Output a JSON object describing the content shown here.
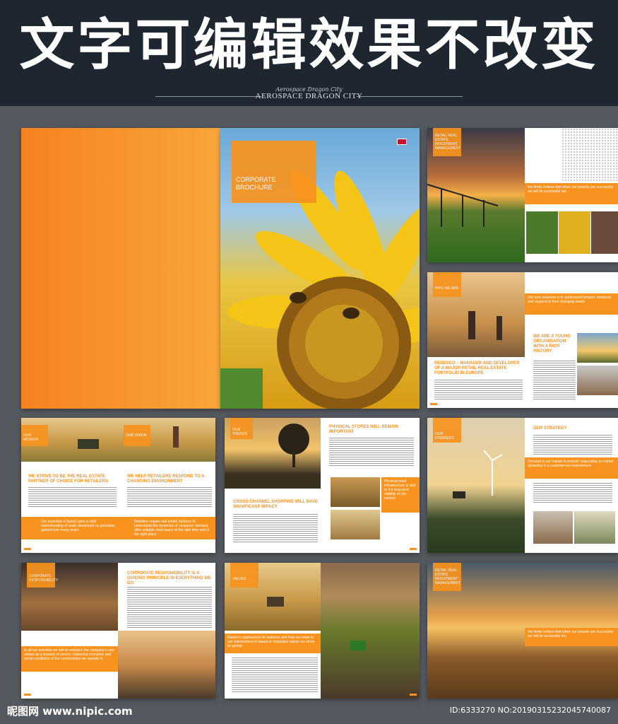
{
  "banner": {
    "title": "文字可编辑效果不改变"
  },
  "logo": {
    "script": "Aerospace Dragon City",
    "name": "AEROSPACE DRAGON CITY"
  },
  "cover": {
    "title": "CORPORATE\nBROCHURE"
  },
  "p_intro": {
    "tag": "RETAIL REAL ESTATE INVESTMENT MANAGEMENT",
    "quote": "We firmly believe that when our tenants are successful we will be successful too"
  },
  "p_who": {
    "tag": "WHO WE ARE",
    "quote": "Our core business is to understand tenants' demands and respond to their changing needs",
    "head1": "REDEVCO – MANAGER AND DEVELOPER OF A MAJOR RETAIL REAL ESTATE PORTFOLIO IN EUROPE",
    "head2": "WE ARE A YOUNG ORGANISATION WITH A RICH HISTORY"
  },
  "p_mission": {
    "tag1": "OUR MISSION",
    "tag2": "OUR VISION",
    "head1": "WE STRIVE TO BE THE REAL ESTATE PARTNER OF CHOICE FOR RETAILERS",
    "head2": "WE HELP RETAILERS RESPOND TO A CHANGING ENVIRONMENT",
    "quote1": "Our expertise is based upon a solid understanding of retail, developed on principles gained over many years",
    "quote2": "Retailers require real estate partners to understand the dynamics of consumer demand, offer suitable retail space at the right time and in the right place"
  },
  "p_trends": {
    "tag": "OUR TRENDS",
    "head1": "PHYSICAL STORES WILL REMAIN IMPORTANT",
    "head2": "CROSS-CHANNEL SHOPPING WILL HAVE SIGNIFICANT IMPACT",
    "quote": "Physical retail infrastructure is vital to the long-term viability of city centres"
  },
  "p_strategy": {
    "tag": "OUR STRATEGY",
    "head": "OUR STRATEGY",
    "quote": "Demand in our market is twofold: responding to market dynamics in a customer-led environment"
  },
  "p_csr": {
    "tag": "CORPORATE RESPONSIBILITY",
    "head": "CORPORATE RESPONSIBILITY IS A GUIDING PRINCIPLE IN EVERYTHING WE DO",
    "quote": "In all our activities we aim to embrace the company's core values as a steward of society, balancing economic and social conditions of the communities we operate in"
  },
  "p_values": {
    "tag": "VALUES",
    "quote": "Redevco approaches its business and how we relate to our stakeholders is based on important values we strive to uphold"
  },
  "p_back": {
    "tag": "RETAIL REAL ESTATE INVESTMENT MANAGEMENT",
    "quote": "We firmly believe that when our tenants are successful we will be successful too"
  },
  "watermark": {
    "site": "昵图网 www.nipic.com",
    "id": "ID:6333270 NO:20190315232045740087"
  },
  "colors": {
    "accent": "#f7931e",
    "bg": "#54595f",
    "banner": "#1e2630"
  }
}
